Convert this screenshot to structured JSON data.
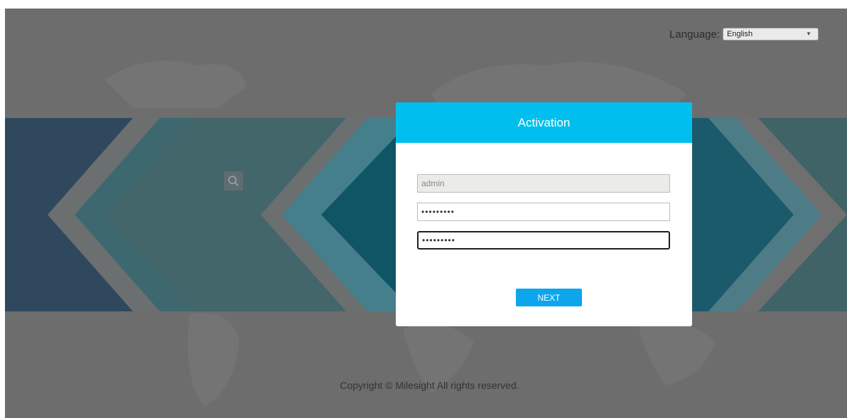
{
  "language": {
    "label": "Language:",
    "selected": "English"
  },
  "dialog": {
    "title": "Activation",
    "username_value": "admin",
    "password_value": "•••••••••",
    "confirm_value": "•••••••••",
    "next_label": "NEXT"
  },
  "footer": {
    "copyright": "Copyright © Milesight All rights reserved."
  },
  "icons": {
    "search": "search-icon",
    "dropdown": "chevron-down-icon"
  },
  "colors": {
    "overlay": "#6d6d6d",
    "header": "#00bfee",
    "button": "#0da5ec"
  }
}
